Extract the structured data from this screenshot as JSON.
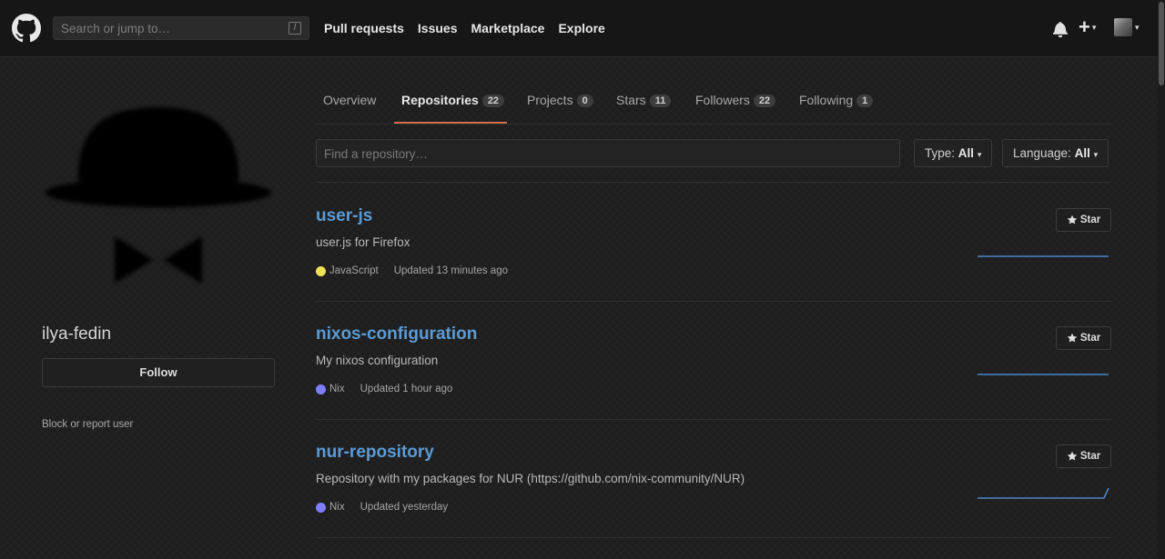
{
  "header": {
    "search_placeholder": "Search or jump to…",
    "slash_key": "/",
    "nav": [
      "Pull requests",
      "Issues",
      "Marketplace",
      "Explore"
    ],
    "plus_glyph": "+",
    "caret": "▾"
  },
  "profile": {
    "username": "ilya-fedin",
    "follow_label": "Follow",
    "block_label": "Block or report user"
  },
  "tabs": [
    {
      "label": "Overview",
      "count": null
    },
    {
      "label": "Repositories",
      "count": "22"
    },
    {
      "label": "Projects",
      "count": "0"
    },
    {
      "label": "Stars",
      "count": "11"
    },
    {
      "label": "Followers",
      "count": "22"
    },
    {
      "label": "Following",
      "count": "1"
    }
  ],
  "filters": {
    "find_placeholder": "Find a repository…",
    "type_label": "Type:",
    "type_value": "All",
    "language_label": "Language:",
    "language_value": "All"
  },
  "repos": [
    {
      "name": "user-js",
      "description": "user.js for Firefox",
      "language": "JavaScript",
      "lang_color": "#f1e05a",
      "updated": "Updated 13 minutes ago",
      "star_label": "Star"
    },
    {
      "name": "nixos-configuration",
      "description": "My nixos configuration",
      "language": "Nix",
      "lang_color": "#7e7eff",
      "updated": "Updated 1 hour ago",
      "star_label": "Star"
    },
    {
      "name": "nur-repository",
      "description": "Repository with my packages for NUR (https://github.com/nix-community/NUR)",
      "language": "Nix",
      "lang_color": "#7e7eff",
      "updated": "Updated yesterday",
      "star_label": "Star"
    }
  ],
  "colors": {
    "accent_underline": "#d26e4b",
    "repo_link": "#5b9bd5",
    "sparkline": "#4a86c8"
  }
}
